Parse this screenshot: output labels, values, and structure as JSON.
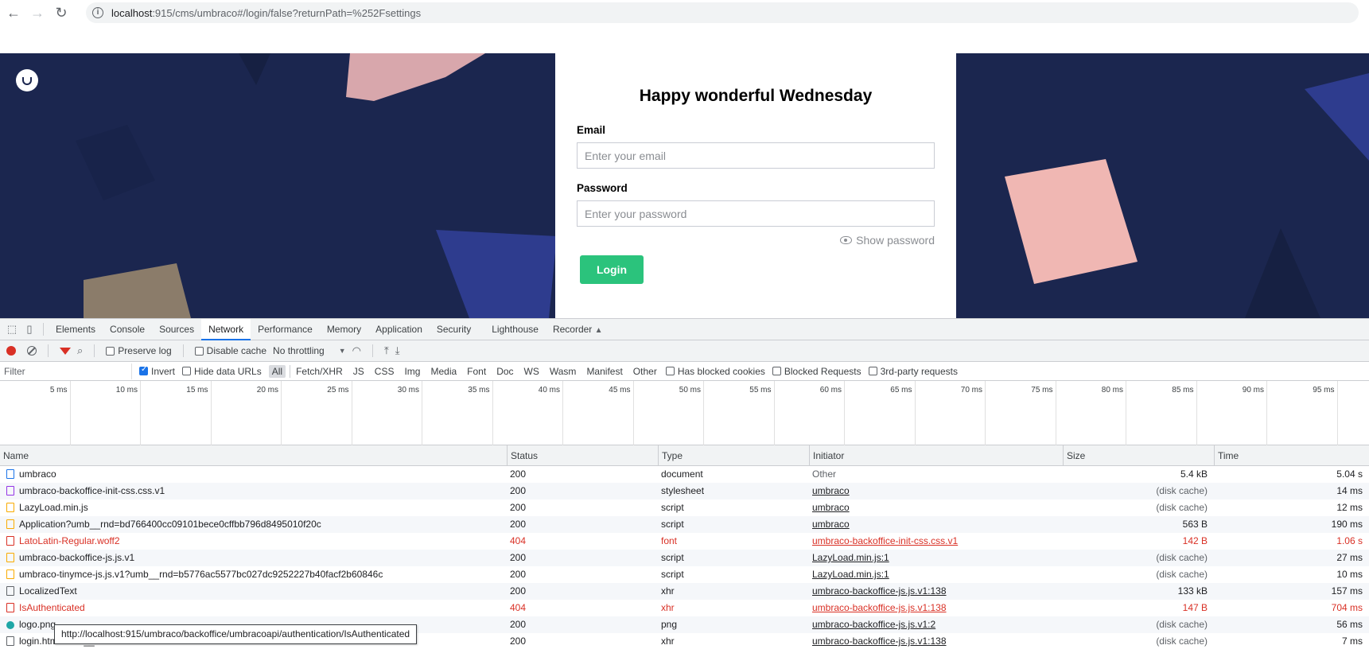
{
  "browser": {
    "url_host": "localhost",
    "url_rest": ":915/cms/umbraco#/login/false?returnPath=%252Fsettings"
  },
  "login": {
    "greeting": "Happy wonderful Wednesday",
    "email_label": "Email",
    "email_placeholder": "Enter your email",
    "password_label": "Password",
    "password_placeholder": "Enter your password",
    "show_password": "Show password",
    "login_button": "Login"
  },
  "devtools": {
    "tabs": [
      "Elements",
      "Console",
      "Sources",
      "Network",
      "Performance",
      "Memory",
      "Application",
      "Security",
      "Lighthouse",
      "Recorder"
    ],
    "active_tab": "Network",
    "toolbar": {
      "preserve_log": "Preserve log",
      "disable_cache": "Disable cache",
      "throttling": "No throttling"
    },
    "filterbar": {
      "filter_placeholder": "Filter",
      "invert": "Invert",
      "hide_data_urls": "Hide data URLs",
      "types": [
        "All",
        "Fetch/XHR",
        "JS",
        "CSS",
        "Img",
        "Media",
        "Font",
        "Doc",
        "WS",
        "Wasm",
        "Manifest",
        "Other"
      ],
      "has_blocked_cookies": "Has blocked cookies",
      "blocked_requests": "Blocked Requests",
      "third_party": "3rd-party requests"
    },
    "timeline_ticks": [
      "5 ms",
      "10 ms",
      "15 ms",
      "20 ms",
      "25 ms",
      "30 ms",
      "35 ms",
      "40 ms",
      "45 ms",
      "50 ms",
      "55 ms",
      "60 ms",
      "65 ms",
      "70 ms",
      "75 ms",
      "80 ms",
      "85 ms",
      "90 ms",
      "95 ms"
    ],
    "columns": [
      "Name",
      "Status",
      "Type",
      "Initiator",
      "Size",
      "Time"
    ],
    "requests": [
      {
        "name": "umbraco",
        "icon": "doc",
        "status": "200",
        "type": "document",
        "initiator": "Other",
        "initiator_link": false,
        "size": "5.4 kB",
        "time": "5.04 s",
        "error": false
      },
      {
        "name": "umbraco-backoffice-init-css.css.v1",
        "icon": "css",
        "status": "200",
        "type": "stylesheet",
        "initiator": "umbraco",
        "initiator_link": true,
        "size": "(disk cache)",
        "time": "14 ms",
        "error": false
      },
      {
        "name": "LazyLoad.min.js",
        "icon": "js",
        "status": "200",
        "type": "script",
        "initiator": "umbraco",
        "initiator_link": true,
        "size": "(disk cache)",
        "time": "12 ms",
        "error": false
      },
      {
        "name": "Application?umb__rnd=bd766400cc09101bece0cffbb796d8495010f20c",
        "icon": "js",
        "status": "200",
        "type": "script",
        "initiator": "umbraco",
        "initiator_link": true,
        "size": "563 B",
        "time": "190 ms",
        "error": false
      },
      {
        "name": "LatoLatin-Regular.woff2",
        "icon": "font",
        "status": "404",
        "type": "font",
        "initiator": "umbraco-backoffice-init-css.css.v1",
        "initiator_link": true,
        "size": "142 B",
        "time": "1.06 s",
        "error": true
      },
      {
        "name": "umbraco-backoffice-js.js.v1",
        "icon": "js",
        "status": "200",
        "type": "script",
        "initiator": "LazyLoad.min.js:1",
        "initiator_link": true,
        "size": "(disk cache)",
        "time": "27 ms",
        "error": false
      },
      {
        "name": "umbraco-tinymce-js.js.v1?umb__rnd=b5776ac5577bc027dc9252227b40facf2b60846c",
        "icon": "js",
        "status": "200",
        "type": "script",
        "initiator": "LazyLoad.min.js:1",
        "initiator_link": true,
        "size": "(disk cache)",
        "time": "10 ms",
        "error": false
      },
      {
        "name": "LocalizedText",
        "icon": "xhr",
        "status": "200",
        "type": "xhr",
        "initiator": "umbraco-backoffice-js.js.v1:138",
        "initiator_link": true,
        "size": "133 kB",
        "time": "157 ms",
        "error": false
      },
      {
        "name": "IsAuthenticated",
        "icon": "err",
        "status": "404",
        "type": "xhr",
        "initiator": "umbraco-backoffice-js.js.v1:138",
        "initiator_link": true,
        "size": "147 B",
        "time": "704 ms",
        "error": true
      },
      {
        "name": "logo.png",
        "icon": "png",
        "status": "200",
        "type": "png",
        "initiator": "umbraco-backoffice-js.js.v1:2",
        "initiator_link": true,
        "size": "(disk cache)",
        "time": "56 ms",
        "error": false
      },
      {
        "name": "login.html?umb__rnd=b5776ac5577bc027dc9252227b40facf2b60846c",
        "icon": "xhr",
        "status": "200",
        "type": "xhr",
        "initiator": "umbraco-backoffice-js.js.v1:138",
        "initiator_link": true,
        "size": "(disk cache)",
        "time": "7 ms",
        "error": false
      }
    ],
    "tooltip": "http://localhost:915/umbraco/backoffice/umbracoapi/authentication/IsAuthenticated"
  }
}
